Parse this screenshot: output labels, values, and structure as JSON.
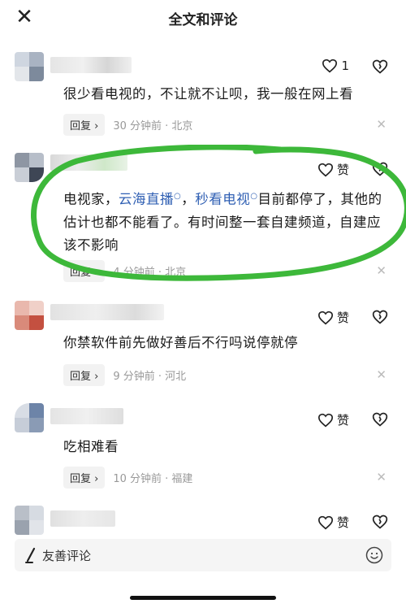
{
  "header": {
    "close_icon_glyph": "✕",
    "title": "全文和评论"
  },
  "comments": [
    {
      "like_count": "1",
      "text": "很少看电视的，不让就不让呗，我一般在网上看",
      "reply_label": "回复 ›",
      "meta": "30 分钟前 · 北京"
    },
    {
      "like_label": "赞",
      "text_part1": "电视家，",
      "link1": "云海直播",
      "sep": "，",
      "link2": "秒看电视",
      "text_part2": "目前都停了，其他的估计也都不能看了。有时间整一套自建频道，自建应该不影响",
      "reply_label": "回复 ›",
      "meta": "4 分钟前 · 北京"
    },
    {
      "like_label": "赞",
      "text": "你禁软件前先做好善后不行吗说停就停",
      "reply_label": "回复 ›",
      "meta": "9 分钟前 · 河北"
    },
    {
      "like_label": "赞",
      "text": "吃相难看",
      "reply_label": "回复 ›",
      "meta": "10 分钟前 · 福建"
    },
    {
      "like_label": "赞"
    }
  ],
  "dismiss_glyph": "✕",
  "input_bar": {
    "placeholder": "友善评论"
  },
  "colors": {
    "link": "#2f5fb3",
    "highlight_stroke": "#3db83a"
  }
}
